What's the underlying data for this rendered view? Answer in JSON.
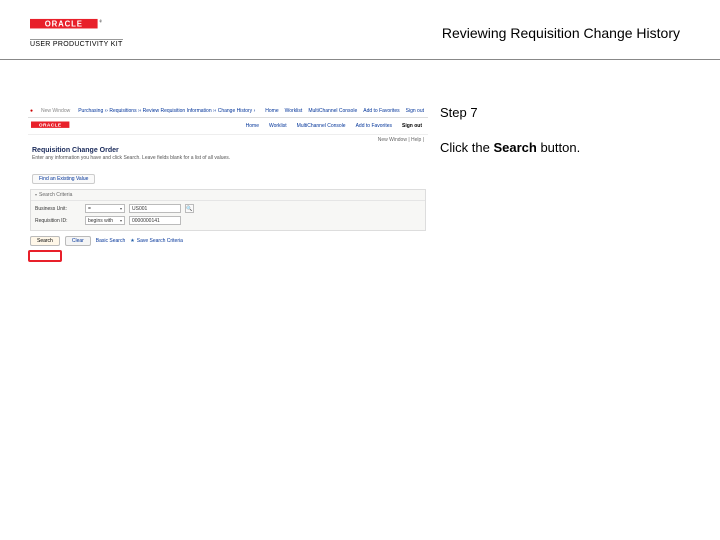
{
  "header": {
    "brand_sub": "USER PRODUCTIVITY KIT",
    "page_title": "Reviewing Requisition Change History"
  },
  "instruction": {
    "step_label": "Step 7",
    "line_prefix": "Click the ",
    "line_bold": "Search",
    "line_suffix": " button."
  },
  "app": {
    "crumbs": "Purchasing  ››  Requisitions  ››  Review Requisition Information  ››  Change History  ›",
    "top_logo": "New Window",
    "top_right_links": [
      "Home",
      "Worklist",
      "MultiChannel Console",
      "Add to Favorites",
      "Sign out"
    ],
    "tabs": [
      "Home",
      "Worklist",
      "MultiChannel Console",
      "Add to Favorites",
      "Sign out"
    ],
    "status_line": "New Window | Help | ",
    "heading": "Requisition Change Order",
    "subheading": "Enter any information you have and click Search. Leave fields blank for a list of all values.",
    "find_button": "Find an Existing Value",
    "panel_title": "Search Criteria",
    "field1_label": "Business Unit:",
    "field1_op": "=",
    "field1_val": "US001",
    "field2_label": "Requisition ID:",
    "field2_op": "begins with",
    "field2_val": "0000000141",
    "actions": {
      "search": "Search",
      "clear": "Clear",
      "basic": "Basic Search",
      "save": "Save Search Criteria"
    }
  }
}
